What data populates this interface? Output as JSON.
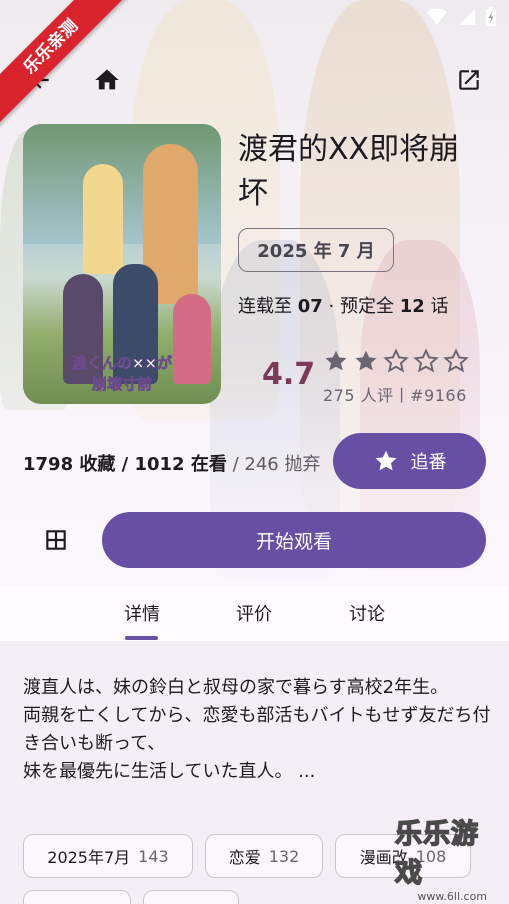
{
  "ribbon": {
    "label": "乐乐亲测"
  },
  "appbar": {
    "back_icon": "arrow-back-icon",
    "home_icon": "home-icon",
    "open_external_icon": "open-in-new-icon"
  },
  "anime": {
    "title": "渡君的XX即将崩坏",
    "air_date": "2025 年 7 月",
    "episodes_prefix": "连载至 ",
    "episodes_current": "07",
    "episodes_mid": " · 预定全 ",
    "episodes_total": "12",
    "episodes_suffix": " 话",
    "rating": "4.7",
    "rating_stars": 2,
    "rating_meta": "275 人评丨#9166",
    "cover_text_line1": "渡くんの××が",
    "cover_text_line2": "崩壊寸前"
  },
  "stats": {
    "collected": "1798 收藏",
    "sep1": " / ",
    "watching": "1012 在看",
    "sep2": " / ",
    "dropped": "246 抛弃"
  },
  "actions": {
    "follow_label": "追番",
    "watch_label": "开始观看"
  },
  "tabs": [
    {
      "label": "详情"
    },
    {
      "label": "评价"
    },
    {
      "label": "讨论"
    }
  ],
  "description": "渡直人は、妹の鈴白と叔母の家で暮らす高校2年生。\n両親を亡くしてから、恋愛も部活もバイトもせず友だち付き合いも断って、\n妹を最優先に生活していた直人。 ...",
  "tags": [
    {
      "label": "2025年7月",
      "count": "143"
    },
    {
      "label": "恋爱",
      "count": "132"
    },
    {
      "label": "漫画改",
      "count": "108"
    }
  ],
  "watermark": {
    "text": "乐乐游戏",
    "url": "www.6ll.com"
  },
  "colors": {
    "primary": "#6750a4",
    "rating": "#7b3a57",
    "ribbon": "#d9232d"
  }
}
